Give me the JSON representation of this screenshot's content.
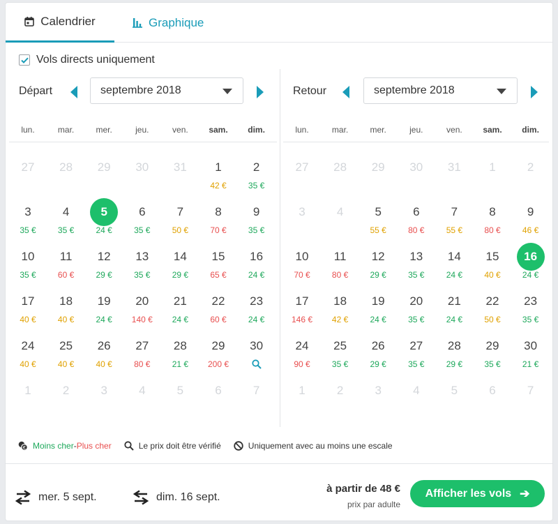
{
  "tabs": [
    {
      "label": "Calendrier",
      "icon": "calendar-icon",
      "active": true
    },
    {
      "label": "Graphique",
      "icon": "bar-chart-icon",
      "active": false
    }
  ],
  "direct_only": {
    "label": "Vols directs uniquement",
    "checked": true
  },
  "weekdays": [
    "lun.",
    "mar.",
    "mer.",
    "jeu.",
    "ven.",
    "sam.",
    "dim."
  ],
  "departure": {
    "label": "Départ",
    "month": "septembre 2018",
    "weeks": [
      [
        {
          "d": "27",
          "m": 1
        },
        {
          "d": "28",
          "m": 1
        },
        {
          "d": "29",
          "m": 1
        },
        {
          "d": "30",
          "m": 1
        },
        {
          "d": "31",
          "m": 1
        },
        {
          "d": "1",
          "p": "42 €",
          "c": "orange"
        },
        {
          "d": "2",
          "p": "35 €",
          "c": "green"
        }
      ],
      [
        {
          "d": "3",
          "p": "35 €",
          "c": "green"
        },
        {
          "d": "4",
          "p": "35 €",
          "c": "green"
        },
        {
          "d": "5",
          "p": "24 €",
          "c": "green",
          "sel": 1
        },
        {
          "d": "6",
          "p": "35 €",
          "c": "green"
        },
        {
          "d": "7",
          "p": "50 €",
          "c": "orange"
        },
        {
          "d": "8",
          "p": "70 €",
          "c": "red"
        },
        {
          "d": "9",
          "p": "35 €",
          "c": "green"
        }
      ],
      [
        {
          "d": "10",
          "p": "35 €",
          "c": "green"
        },
        {
          "d": "11",
          "p": "60 €",
          "c": "red"
        },
        {
          "d": "12",
          "p": "29 €",
          "c": "green"
        },
        {
          "d": "13",
          "p": "35 €",
          "c": "green"
        },
        {
          "d": "14",
          "p": "29 €",
          "c": "green"
        },
        {
          "d": "15",
          "p": "65 €",
          "c": "red"
        },
        {
          "d": "16",
          "p": "24 €",
          "c": "green"
        }
      ],
      [
        {
          "d": "17",
          "p": "40 €",
          "c": "orange"
        },
        {
          "d": "18",
          "p": "40 €",
          "c": "orange"
        },
        {
          "d": "19",
          "p": "24 €",
          "c": "green"
        },
        {
          "d": "20",
          "p": "140 €",
          "c": "red"
        },
        {
          "d": "21",
          "p": "24 €",
          "c": "green"
        },
        {
          "d": "22",
          "p": "60 €",
          "c": "red"
        },
        {
          "d": "23",
          "p": "24 €",
          "c": "green"
        }
      ],
      [
        {
          "d": "24",
          "p": "40 €",
          "c": "orange"
        },
        {
          "d": "25",
          "p": "40 €",
          "c": "orange"
        },
        {
          "d": "26",
          "p": "40 €",
          "c": "orange"
        },
        {
          "d": "27",
          "p": "80 €",
          "c": "red"
        },
        {
          "d": "28",
          "p": "21 €",
          "c": "green"
        },
        {
          "d": "29",
          "p": "200 €",
          "c": "red"
        },
        {
          "d": "30",
          "search": 1
        }
      ],
      [
        {
          "d": "1",
          "m": 1
        },
        {
          "d": "2",
          "m": 1
        },
        {
          "d": "3",
          "m": 1
        },
        {
          "d": "4",
          "m": 1
        },
        {
          "d": "5",
          "m": 1
        },
        {
          "d": "6",
          "m": 1
        },
        {
          "d": "7",
          "m": 1
        }
      ]
    ]
  },
  "return": {
    "label": "Retour",
    "month": "septembre 2018",
    "weeks": [
      [
        {
          "d": "27",
          "m": 1
        },
        {
          "d": "28",
          "m": 1
        },
        {
          "d": "29",
          "m": 1
        },
        {
          "d": "30",
          "m": 1
        },
        {
          "d": "31",
          "m": 1
        },
        {
          "d": "1",
          "m": 1
        },
        {
          "d": "2",
          "m": 1
        }
      ],
      [
        {
          "d": "3",
          "m": 1
        },
        {
          "d": "4",
          "m": 1
        },
        {
          "d": "5",
          "p": "55 €",
          "c": "orange"
        },
        {
          "d": "6",
          "p": "80 €",
          "c": "red"
        },
        {
          "d": "7",
          "p": "55 €",
          "c": "orange"
        },
        {
          "d": "8",
          "p": "80 €",
          "c": "red"
        },
        {
          "d": "9",
          "p": "46 €",
          "c": "orange"
        }
      ],
      [
        {
          "d": "10",
          "p": "70 €",
          "c": "red"
        },
        {
          "d": "11",
          "p": "80 €",
          "c": "red"
        },
        {
          "d": "12",
          "p": "29 €",
          "c": "green"
        },
        {
          "d": "13",
          "p": "35 €",
          "c": "green"
        },
        {
          "d": "14",
          "p": "24 €",
          "c": "green"
        },
        {
          "d": "15",
          "p": "40 €",
          "c": "orange"
        },
        {
          "d": "16",
          "p": "24 €",
          "c": "green",
          "sel": 1
        }
      ],
      [
        {
          "d": "17",
          "p": "146 €",
          "c": "red"
        },
        {
          "d": "18",
          "p": "42 €",
          "c": "orange"
        },
        {
          "d": "19",
          "p": "24 €",
          "c": "green"
        },
        {
          "d": "20",
          "p": "35 €",
          "c": "green"
        },
        {
          "d": "21",
          "p": "24 €",
          "c": "green"
        },
        {
          "d": "22",
          "p": "50 €",
          "c": "orange"
        },
        {
          "d": "23",
          "p": "35 €",
          "c": "green"
        }
      ],
      [
        {
          "d": "24",
          "p": "90 €",
          "c": "red"
        },
        {
          "d": "25",
          "p": "35 €",
          "c": "green"
        },
        {
          "d": "26",
          "p": "29 €",
          "c": "green"
        },
        {
          "d": "27",
          "p": "35 €",
          "c": "green"
        },
        {
          "d": "28",
          "p": "29 €",
          "c": "green"
        },
        {
          "d": "29",
          "p": "35 €",
          "c": "green"
        },
        {
          "d": "30",
          "p": "21 €",
          "c": "green"
        }
      ],
      [
        {
          "d": "1",
          "m": 1
        },
        {
          "d": "2",
          "m": 1
        },
        {
          "d": "3",
          "m": 1
        },
        {
          "d": "4",
          "m": 1
        },
        {
          "d": "5",
          "m": 1
        },
        {
          "d": "6",
          "m": 1
        },
        {
          "d": "7",
          "m": 1
        }
      ]
    ]
  },
  "legend": {
    "cheaper": "Moins cher",
    "separator": " - ",
    "dearer": "Plus cher",
    "verify": "Le prix doit être vérifié",
    "stopover": "Uniquement avec au moins une escale"
  },
  "footer": {
    "outbound": "mer. 5 sept.",
    "inbound": "dim. 16 sept.",
    "from_price": "à partir de 48 €",
    "per_adult": "prix par adulte",
    "show_button": "Afficher les vols",
    "show_arrow": "➔"
  },
  "colors": {
    "accent": "#1a9cb8",
    "green": "#1dbf6b",
    "orange": "#e0a100",
    "red": "#e84f4f"
  }
}
